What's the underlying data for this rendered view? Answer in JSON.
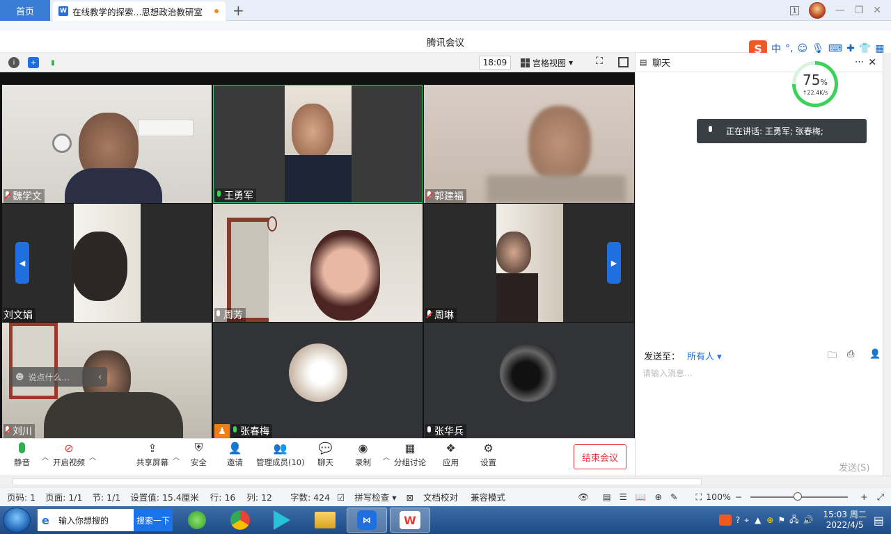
{
  "wps": {
    "home_tab": "首页",
    "doc_tab": "在线教学的探索...思想政治教研室",
    "new_tab": "+",
    "window_badge": "1"
  },
  "meeting": {
    "title": "腾讯会议",
    "time": "18:09",
    "view_mode": "宫格视图",
    "participants": [
      {
        "name": "魏学文",
        "mic": "off"
      },
      {
        "name": "王勇军",
        "mic": "on"
      },
      {
        "name": "郭建福",
        "mic": "off"
      },
      {
        "name": "刘文娟",
        "mic": "none"
      },
      {
        "name": "周芳",
        "mic": "idle"
      },
      {
        "name": "周琳",
        "mic": "off"
      },
      {
        "name": "刘川",
        "mic": "off"
      },
      {
        "name": "张春梅",
        "mic": "on"
      },
      {
        "name": "张华兵",
        "mic": "idle"
      }
    ],
    "chat_prompt": "说点什么...",
    "toolbar": {
      "mute": "静音",
      "video": "开启视频",
      "share": "共享屏幕",
      "security": "安全",
      "invite": "邀请",
      "members": "管理成员(10)",
      "chat": "聊天",
      "record": "录制",
      "breakout": "分组讨论",
      "apps": "应用",
      "settings": "设置",
      "end": "结束会议"
    }
  },
  "chat": {
    "title": "聊天",
    "speaking": "正在讲话: 王勇军; 张春梅;",
    "net_percent": "75",
    "net_unit": "%",
    "net_speed": "↑22.4K/s",
    "send_to_label": "发送至：",
    "send_to_value": "所有人",
    "input_placeholder": "请输入消息...",
    "send": "发送(S)"
  },
  "ime": {
    "lang": "中"
  },
  "status": {
    "page_code": "页码: 1",
    "page": "页面: 1/1",
    "section": "节: 1/1",
    "setting": "设置值: 15.4厘米",
    "row": "行: 16",
    "col": "列: 12",
    "words": "字数: 424",
    "spell": "拼写检查",
    "proof": "文档校对",
    "compat": "兼容模式",
    "zoom": "100%"
  },
  "taskbar": {
    "search_placeholder": "输入你想搜的",
    "search_button": "搜索一下",
    "time": "15:03 周二",
    "date": "2022/4/5"
  }
}
